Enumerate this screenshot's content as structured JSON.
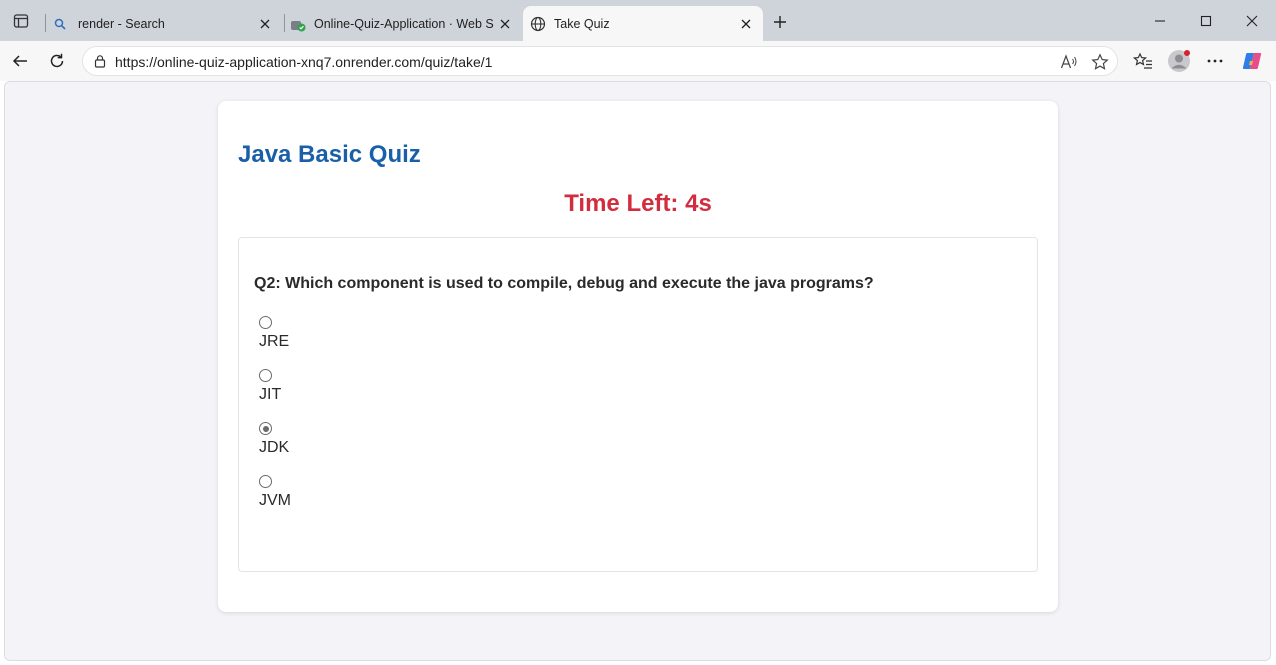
{
  "browser": {
    "tabs": [
      {
        "title": "render - Search",
        "icon": "search-icon",
        "active": false
      },
      {
        "title": "Online-Quiz-Application · Web Se",
        "icon": "render-app-icon",
        "active": false
      },
      {
        "title": "Take Quiz",
        "icon": "globe-icon",
        "active": true
      }
    ],
    "address": {
      "url": "https://online-quiz-application-xnq7.onrender.com/quiz/take/1"
    }
  },
  "quiz": {
    "title": "Java Basic Quiz",
    "timer": "Time Left: 4s",
    "question": "Q2: Which component is used to compile, debug and execute the java programs?",
    "options": [
      {
        "label": "JRE",
        "checked": false
      },
      {
        "label": "JIT",
        "checked": false
      },
      {
        "label": "JDK",
        "checked": true
      },
      {
        "label": "JVM",
        "checked": false
      }
    ]
  },
  "colors": {
    "title": "#1a5fa8",
    "timer": "#d12d3f",
    "page_bg": "#f4f4f8",
    "tabbar_bg": "#cfd3da"
  }
}
